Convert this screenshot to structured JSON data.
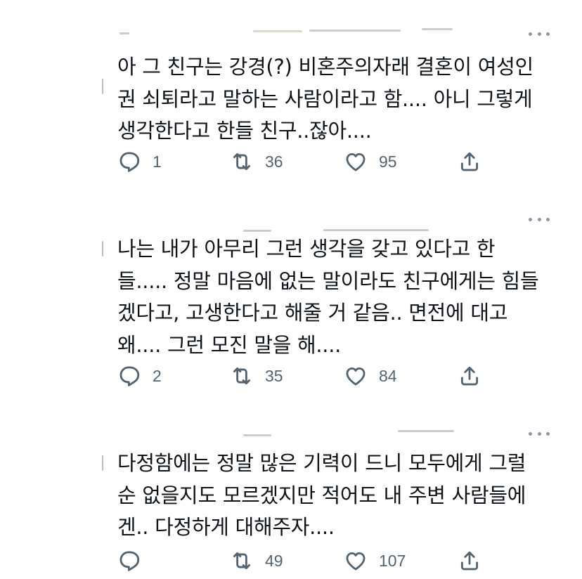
{
  "tweets": [
    {
      "text_lines": [
        "아 그 친구는 강경(?) 비혼주의자래 결혼이 여성인",
        "권 쇠퇴라고 말하는 사람이라고 함.... 아니 그렇게",
        "생각한다고 한들 친구..잖아...."
      ],
      "reply_count": "1",
      "retweet_count": "36",
      "like_count": "95"
    },
    {
      "text_lines": [
        "나는 내가 아무리 그런 생각을 갖고 있다고 한",
        "들..... 정말 마음에 없는 말이라도 친구에게는 힘들",
        "겠다고, 고생한다고 해줄 거 같음.. 면전에 대고",
        "왜.... 그런 모진 말을 해...."
      ],
      "reply_count": "2",
      "retweet_count": "35",
      "like_count": "84"
    },
    {
      "text_lines": [
        "다정함에는 정말 많은 기력이 드니 모두에게 그럴",
        "순 없을지도 모르겠지만 적어도 내 주변 사람들에",
        "겐.. 다정하게 대해주자...."
      ],
      "reply_count": "",
      "retweet_count": "49",
      "like_count": "107"
    }
  ],
  "icons": {
    "reply": "reply-bubble-icon",
    "retweet": "retweet-icon",
    "like": "heart-icon",
    "share": "share-icon",
    "more": "more-dots-icon"
  },
  "colors": {
    "text": "#0f1419",
    "icon": "#536471",
    "dots": "#8b98a5",
    "background": "#ffffff"
  }
}
